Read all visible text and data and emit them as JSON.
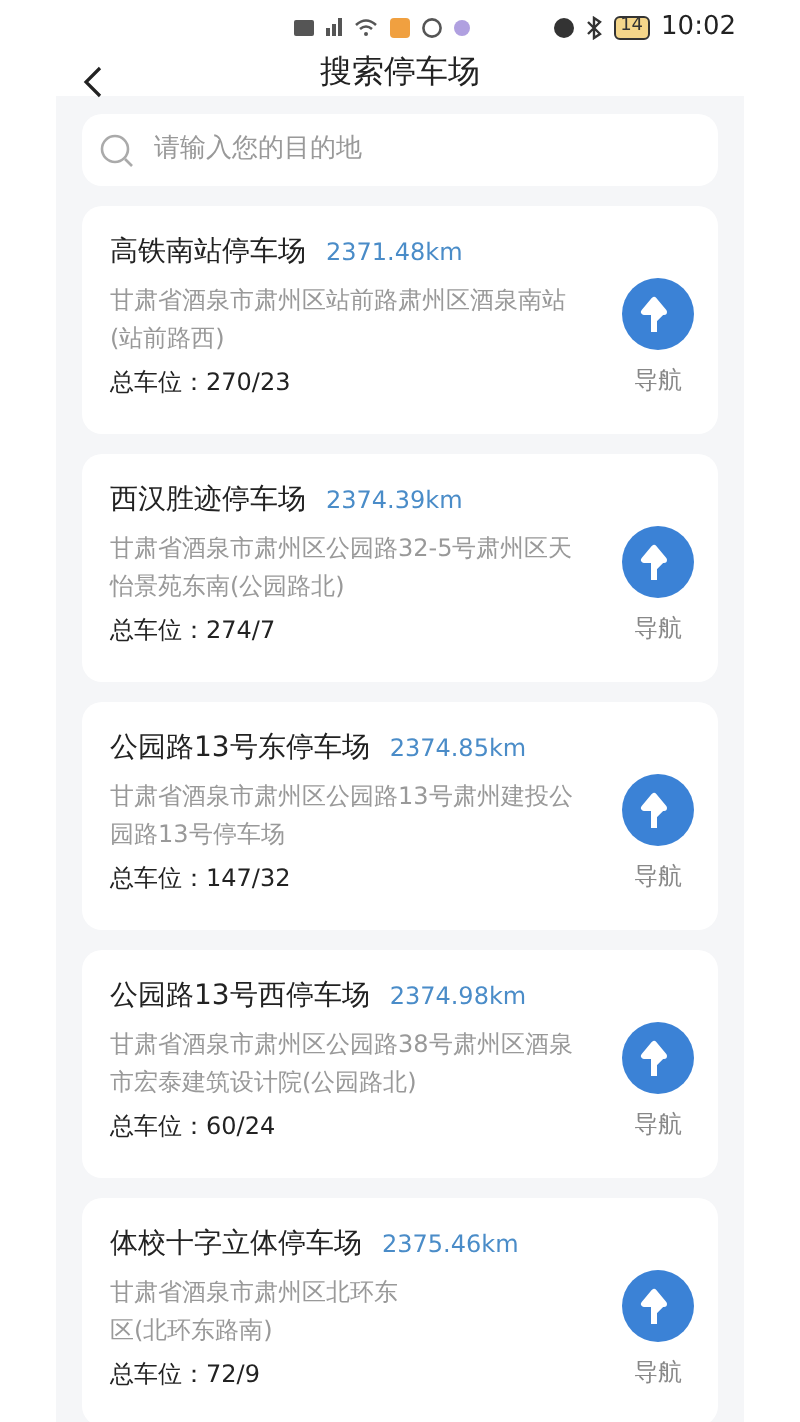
{
  "status_bar": {
    "time": "10:02",
    "battery": "14"
  },
  "header": {
    "title": "搜索停车场"
  },
  "search": {
    "placeholder": "请输入您的目的地"
  },
  "parkings": [
    {
      "name": "高铁南站停车场",
      "distance": "2371.48km",
      "address_lines": [
        "甘肃省酒泉市肃州区站前路肃州区酒泉南站",
        "(站前路西)"
      ],
      "total": "总车位：270/23",
      "nav_label": "导航"
    },
    {
      "name": "西汉胜迹停车场",
      "distance": "2374.39km",
      "address_lines": [
        "甘肃省酒泉市肃州区公园路32-5号肃州区天",
        "怡景苑东南(公园路北)"
      ],
      "total": "总车位：274/7",
      "nav_label": "导航"
    },
    {
      "name": "公园路13号东停车场",
      "distance": "2374.85km",
      "address_lines": [
        "甘肃省酒泉市肃州区公园路13号肃州建投公",
        "园路13号停车场"
      ],
      "total": "总车位：147/32",
      "nav_label": "导航"
    },
    {
      "name": "公园路13号西停车场",
      "distance": "2374.98km",
      "address_lines": [
        "甘肃省酒泉市肃州区公园路38号肃州区酒泉",
        "市宏泰建筑设计院(公园路北)"
      ],
      "total": "总车位：60/24",
      "nav_label": "导航"
    },
    {
      "name": "体校十字立体停车场",
      "distance": "2375.46km",
      "address_lines": [
        "甘肃省酒泉市肃州区北环东",
        "区(北环东路南)"
      ],
      "total": "总车位：72/9",
      "nav_label": "导航"
    }
  ]
}
